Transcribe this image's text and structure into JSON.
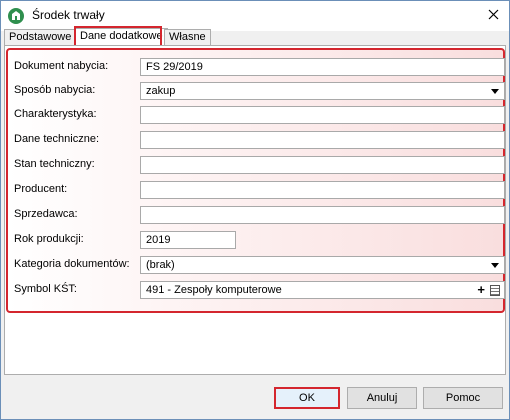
{
  "window": {
    "title": "Środek trwały"
  },
  "icons": {
    "app": "app-icon",
    "close": "close-icon"
  },
  "tabs": [
    {
      "label": "Podstawowe"
    },
    {
      "label": "Dane dodatkowe"
    },
    {
      "label": "Własne"
    }
  ],
  "active_tab": "Dane dodatkowe",
  "form": {
    "dokument_nabycia": {
      "label": "Dokument nabycia:",
      "value": "FS 29/2019"
    },
    "sposob_nabycia": {
      "label": "Sposób nabycia:",
      "value": "zakup"
    },
    "charakterystyka": {
      "label": "Charakterystyka:",
      "value": ""
    },
    "dane_techniczne": {
      "label": "Dane techniczne:",
      "value": ""
    },
    "stan_techniczny": {
      "label": "Stan techniczny:",
      "value": ""
    },
    "producent": {
      "label": "Producent:",
      "value": ""
    },
    "sprzedawca": {
      "label": "Sprzedawca:",
      "value": ""
    },
    "rok_produkcji": {
      "label": "Rok produkcji:",
      "value": "2019"
    },
    "kategoria_dokumentow": {
      "label": "Kategoria dokumentów:",
      "value": "(brak)"
    },
    "symbol_kst": {
      "label": "Symbol KŚT:",
      "value": "491 - Zespoły komputerowe"
    }
  },
  "buttons": {
    "ok": "OK",
    "cancel": "Anuluj",
    "help": "Pomoc"
  },
  "colors": {
    "highlight": "#d4262e",
    "app_icon": "#2f8f4e"
  }
}
